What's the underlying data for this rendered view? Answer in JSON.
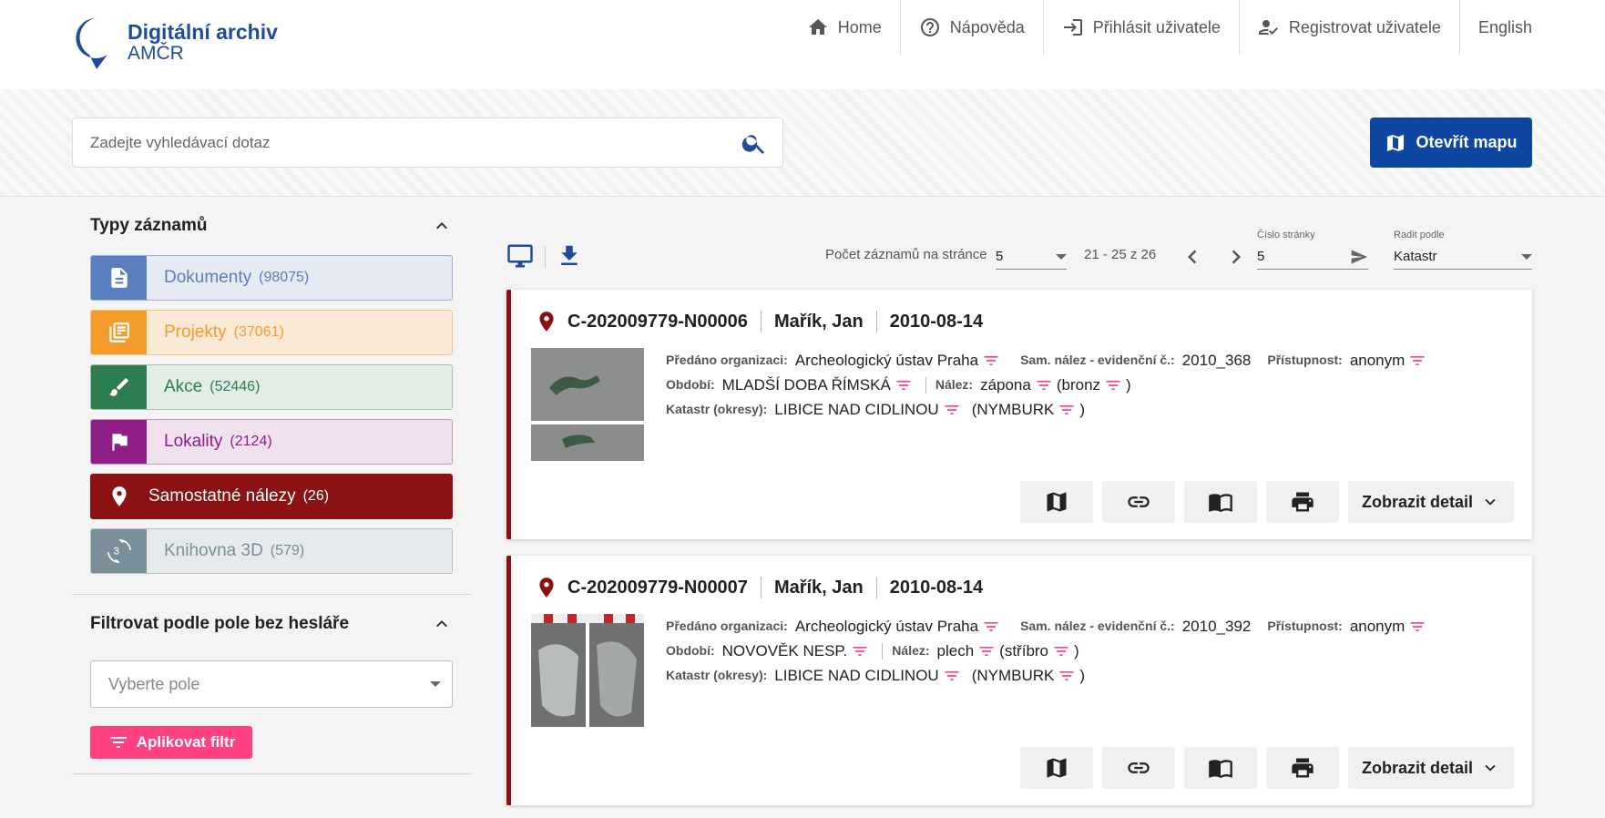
{
  "brand": {
    "line1": "Digitální archiv",
    "line2": "AMČR"
  },
  "topnav": {
    "home": "Home",
    "help": "Nápověda",
    "login": "Přihlásit uživatele",
    "register": "Registrovat uživatele",
    "language": "English"
  },
  "search": {
    "placeholder": "Zadejte vyhledávací dotaz",
    "map_button": "Otevřít mapu"
  },
  "sidebar": {
    "types_title": "Typy záznamů",
    "types": [
      {
        "label": "Dokumenty",
        "count": "(98075)",
        "icon": "document-icon"
      },
      {
        "label": "Projekty",
        "count": "(37061)",
        "icon": "projects-icon"
      },
      {
        "label": "Akce",
        "count": "(52446)",
        "icon": "brush-icon"
      },
      {
        "label": "Lokality",
        "count": "(2124)",
        "icon": "flag-icon"
      },
      {
        "label": "Samostatné nálezy",
        "count": "(26)",
        "icon": "location-pin-icon"
      },
      {
        "label": "Knihovna 3D",
        "count": "(579)",
        "icon": "3d-rotation-icon"
      }
    ],
    "filter_title": "Filtrovat podle pole bez hesláře",
    "filter_placeholder": "Vyberte pole",
    "apply_label": "Aplikovat filtr"
  },
  "toolbar": {
    "per_page_label": "Počet záznamů na stránce",
    "per_page_value": "5",
    "range": "21 - 25 z 26",
    "page_label": "Číslo stránky",
    "page_value": "5",
    "sort_label": "Radit podle",
    "sort_value": "Katastr"
  },
  "labels": {
    "organization": "Předáno organizaci:",
    "evidence": "Sam. nález - evidenční č.:",
    "access": "Přístupnost:",
    "period": "Období:",
    "find": "Nález:",
    "cadastre": "Katastr (okresy):",
    "detail": "Zobrazit detail"
  },
  "records": [
    {
      "id": "C-202009779-N00006",
      "author": "Mařík, Jan",
      "date": "2010-08-14",
      "organization": "Archeologický ústav Praha",
      "evidence": "2010_368",
      "access": "anonym",
      "period": "MLADŠÍ DOBA ŘÍMSKÁ",
      "find": "zápona",
      "material_open": "(bronz",
      "material_close": ")",
      "cadastre": "LIBICE NAD CIDLINOU",
      "district_open": "(NYMBURK",
      "district_close": ")"
    },
    {
      "id": "C-202009779-N00007",
      "author": "Mařík, Jan",
      "date": "2010-08-14",
      "organization": "Archeologický ústav Praha",
      "evidence": "2010_392",
      "access": "anonym",
      "period": "NOVOVĚK NESP.",
      "find": "plech",
      "material_open": "(stříbro",
      "material_close": ")",
      "cadastre": "LIBICE NAD CIDLINOU",
      "district_open": "(NYMBURK",
      "district_close": ")"
    }
  ],
  "colors": {
    "brand": "#1e4c9a",
    "accent_pink": "#ff4081",
    "record_red": "#8b1212",
    "dokumenty": "#5a7fbf",
    "projekty": "#f39c2b",
    "akce": "#2e7d4f",
    "lokality": "#8e1f86",
    "knihovna": "#7b8f9a"
  }
}
